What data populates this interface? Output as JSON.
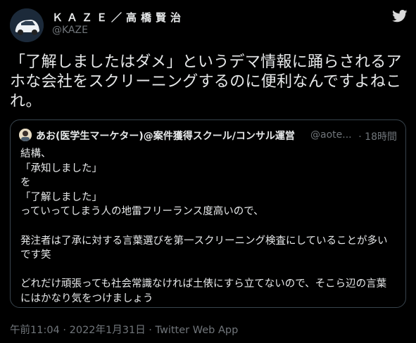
{
  "author": {
    "display_name": "ＫＡＺＥ／高橋賢治",
    "handle": "@KAZE",
    "avatar_icon": "car-avatar-icon"
  },
  "brand_icon": "twitter-bird-icon",
  "tweet": {
    "text": "「了解しましたはダメ」というデマ情報に踊らされるアホな会社をスクリーニングするのに便利なんですよねこれ。"
  },
  "quoted": {
    "display_name": "あお(医学生マーケター)@案件獲得スクール/コンサル運営",
    "handle": "@aote...",
    "time": "· 18時間",
    "lines": [
      "結構、",
      "「承知しました」",
      "を",
      "「了解しました」",
      "っていってしまう人の地雷フリーランス度高いので、",
      "",
      "発注者は了承に対する言葉選びを第一スクリーニング検査にしていることが多い",
      "です笑",
      "",
      "どれだけ頑張っても社会常識なければ土俵にすら立てないので、そこら辺の言葉",
      "にはかなり気をつけましょう"
    ]
  },
  "meta": {
    "timestamp": "午前11:04 · 2022年1月31日 · Twitter Web App"
  },
  "colors": {
    "background": "#000000",
    "text": "#e7e9ea",
    "secondary": "#71767b",
    "border": "#38444d",
    "accent": "#1d9bf0"
  }
}
